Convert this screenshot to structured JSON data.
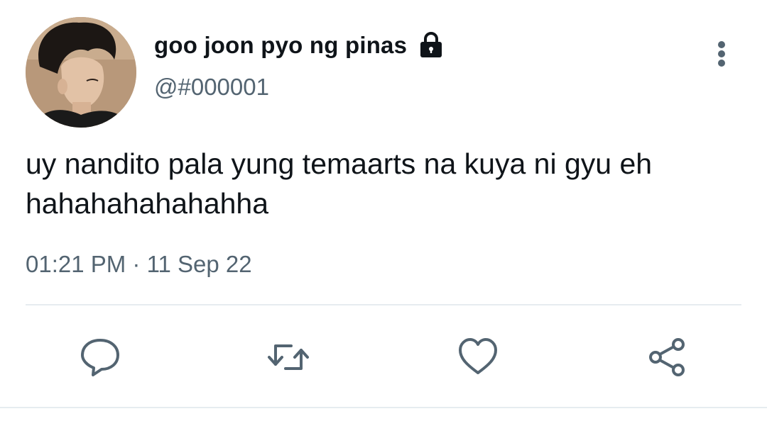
{
  "tweet": {
    "display_name": "goo joon pyo ng pinas",
    "handle": "@#000001",
    "protected_icon": "lock-icon",
    "text_line1": "uy nandito pala yung temaarts na kuya ni gyu eh",
    "text_line2": "hahahahahahahha",
    "time": "01:21 PM",
    "separator": "·",
    "date": "11 Sep 22"
  },
  "actions": [
    {
      "name": "reply",
      "icon": "speech-bubble-icon"
    },
    {
      "name": "retweet",
      "icon": "retweet-icon"
    },
    {
      "name": "like",
      "icon": "heart-icon"
    },
    {
      "name": "share",
      "icon": "share-icon"
    }
  ],
  "colors": {
    "text_primary": "#0f1419",
    "text_secondary": "#536471",
    "divider": "#e6ecf0"
  }
}
